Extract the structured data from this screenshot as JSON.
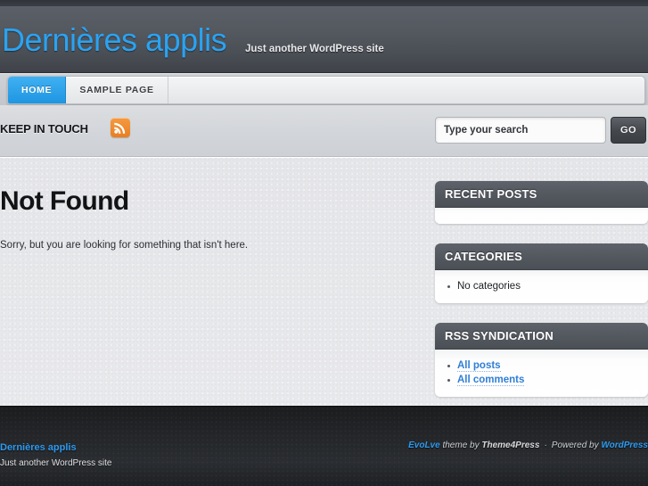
{
  "header": {
    "site_title": "Dernières applis",
    "site_description": "Just another WordPress site",
    "title_color": "#2aa3f2"
  },
  "nav": {
    "items": [
      {
        "label": "HOME",
        "active": true
      },
      {
        "label": "SAMPLE PAGE",
        "active": false
      }
    ]
  },
  "social_bar": {
    "label": "KEEP IN TOUCH",
    "rss_icon": "rss-icon"
  },
  "search": {
    "placeholder": "Type your search",
    "value": "",
    "button_label": "GO"
  },
  "main": {
    "title": "Not Found",
    "body": "Sorry, but you are looking for something that isn't here."
  },
  "sidebar": {
    "widgets": [
      {
        "title": "RECENT POSTS",
        "items": []
      },
      {
        "title": "CATEGORIES",
        "items": [
          {
            "label": "No categories",
            "link": false
          }
        ]
      },
      {
        "title": "RSS SYNDICATION",
        "items": [
          {
            "label": "All posts",
            "link": true
          },
          {
            "label": "All comments",
            "link": true
          }
        ]
      }
    ]
  },
  "footer": {
    "site_title": "Dernières applis",
    "site_description": "Just another WordPress site",
    "credit_theme": "EvoLve",
    "credit_theme_by": " theme by ",
    "credit_author": "Theme4Press",
    "credit_separator": "·",
    "credit_powered": "Powered by ",
    "credit_platform": "WordPress",
    "link_color": "#2d9bf0"
  }
}
